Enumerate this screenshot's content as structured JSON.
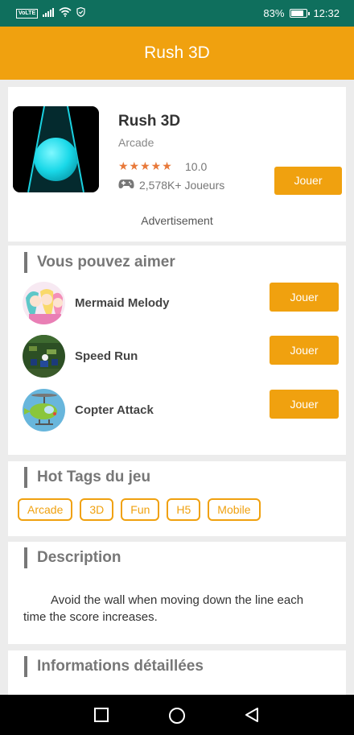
{
  "status": {
    "carrier_badge": "VoLTE",
    "battery": "83%",
    "battery_level": 0.83,
    "time": "12:32"
  },
  "appbar": {
    "title": "Rush 3D"
  },
  "game": {
    "title": "Rush 3D",
    "category": "Arcade",
    "stars": "★★★★★",
    "rating": "10.0",
    "players": "2,578K+ Joueurs",
    "play_label": "Jouer",
    "ad_label": "Advertisement"
  },
  "recommend": {
    "title": "Vous pouvez aimer",
    "items": [
      {
        "name": "Mermaid Melody",
        "play_label": "Jouer"
      },
      {
        "name": "Speed Run",
        "play_label": "Jouer"
      },
      {
        "name": "Copter Attack",
        "play_label": "Jouer"
      }
    ]
  },
  "tags": {
    "title": "Hot Tags du jeu",
    "items": [
      "Arcade",
      "3D",
      "Fun",
      "H5",
      "Mobile"
    ]
  },
  "description": {
    "title": "Description",
    "text": "Avoid the wall when moving down the line each time the score increases."
  },
  "info": {
    "title": "Informations détaillées"
  },
  "colors": {
    "accent": "#f0a10f",
    "statusbar": "#0f6f5d",
    "star": "#e8793a"
  }
}
